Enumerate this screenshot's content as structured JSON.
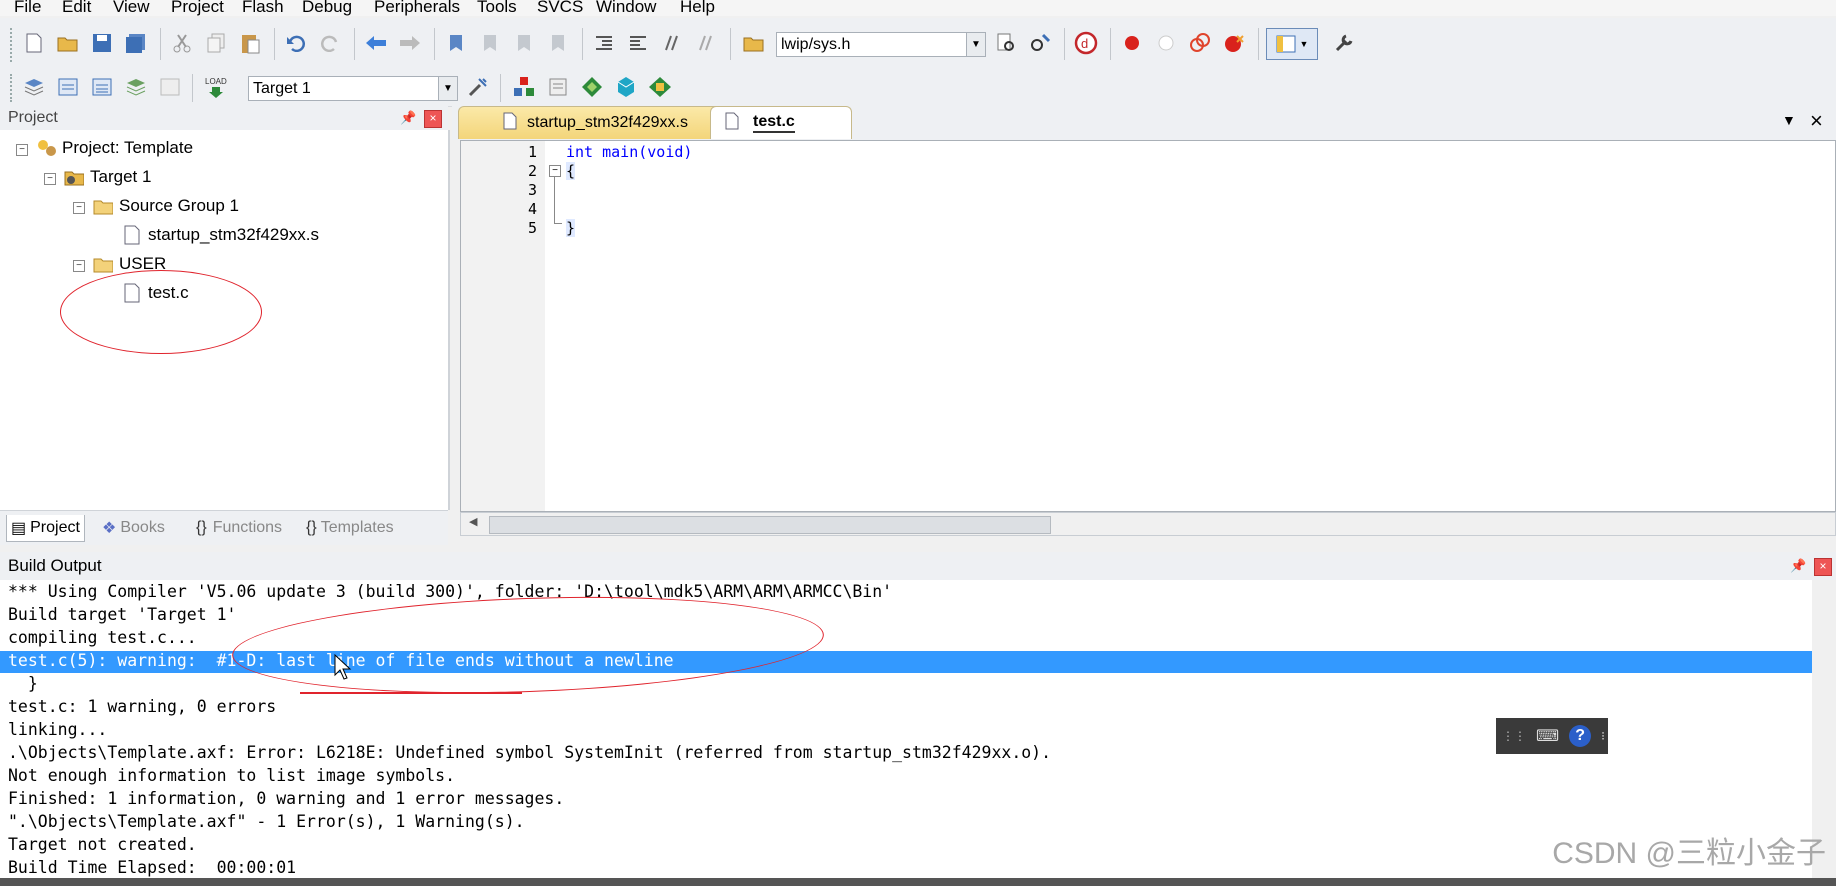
{
  "menu": [
    "File",
    "Edit",
    "View",
    "Project",
    "Flash",
    "Debug",
    "Peripherals",
    "Tools",
    "SVCS",
    "Window",
    "Help"
  ],
  "toolbar": {
    "find_combo_value": "lwip/sys.h",
    "target_combo_value": "Target 1"
  },
  "project_panel": {
    "title": "Project",
    "tree": {
      "root": "Project: Template",
      "target": "Target 1",
      "source_group": "Source Group 1",
      "startup_file": "startup_stm32f429xx.s",
      "user_group": "USER",
      "user_file": "test.c"
    },
    "tabs": [
      "Project",
      "Books",
      "Functions",
      "Templates"
    ]
  },
  "editor": {
    "tabs": [
      "startup_stm32f429xx.s",
      "test.c"
    ],
    "active_tab": "test.c",
    "line_numbers": [
      "1",
      "2",
      "3",
      "4",
      "5"
    ],
    "lines": [
      "int main(void)",
      "{",
      "",
      "",
      "}"
    ]
  },
  "build_output": {
    "title": "Build Output",
    "lines": [
      "*** Using Compiler 'V5.06 update 3 (build 300)', folder: 'D:\\tool\\mdk5\\ARM\\ARM\\ARMCC\\Bin'",
      "Build target 'Target 1'",
      "compiling test.c...",
      "test.c(5): warning:  #1-D: last line of file ends without a newline",
      "  }",
      "test.c: 1 warning, 0 errors",
      "linking...",
      ".\\Objects\\Template.axf: Error: L6218E: Undefined symbol SystemInit (referred from startup_stm32f429xx.o).",
      "Not enough information to list image symbols.",
      "Finished: 1 information, 0 warning and 1 error messages.",
      "\".\\Objects\\Template.axf\" - 1 Error(s), 1 Warning(s).",
      "Target not created.",
      "Build Time Elapsed:  00:00:01"
    ],
    "selected_line_index": 3
  },
  "watermark": "CSDN @三粒小金子",
  "colors": {
    "selection": "#3399ff",
    "annotation": "#e0242d",
    "keyword": "#0000ff"
  }
}
